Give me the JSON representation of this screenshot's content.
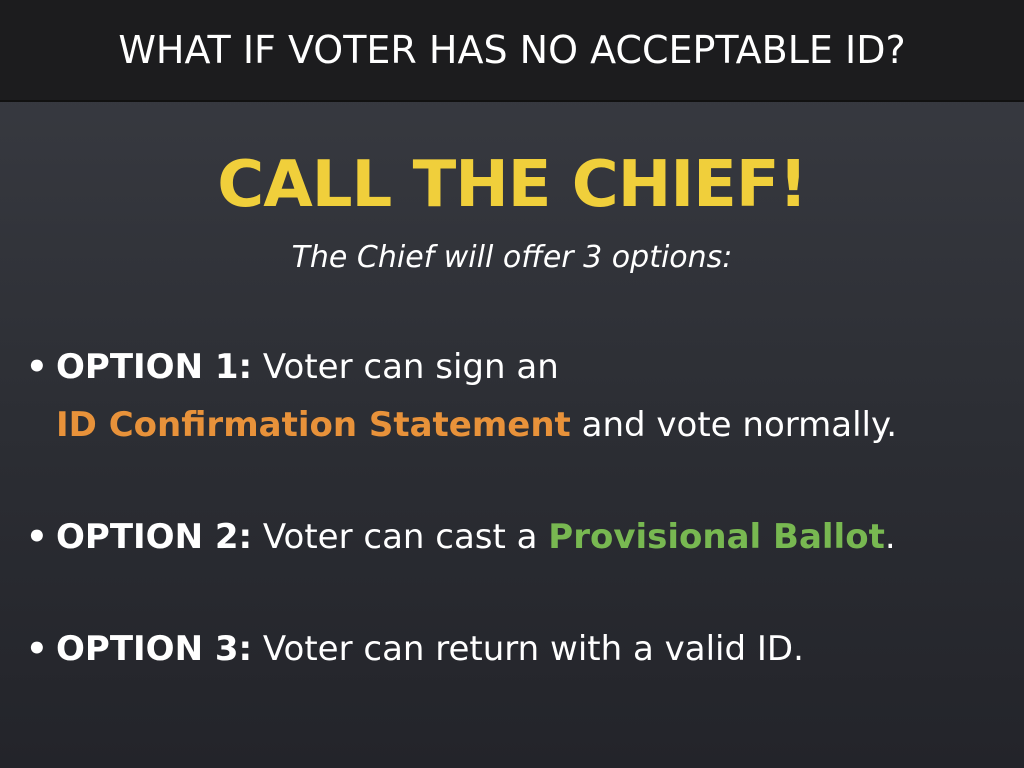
{
  "colors": {
    "headline": "#f0cf3b",
    "accent_orange": "#e8923a",
    "accent_green": "#78b851"
  },
  "header": {
    "title": "WHAT IF VOTER HAS NO ACCEPTABLE ID?"
  },
  "headline": "CALL THE CHIEF!",
  "subhead": "The Chief will offer 3 options:",
  "bullet_glyph": "•",
  "options": [
    {
      "label": "OPTION 1:",
      "text_before": " Voter can sign an",
      "highlight": "ID Confirmation Statement",
      "text_after": " and vote normally."
    },
    {
      "label": "OPTION 2:",
      "text_before": " Voter can cast a ",
      "highlight": "Provisional Ballot",
      "text_after": "."
    },
    {
      "label": "OPTION 3:",
      "text_before": " Voter can return with a valid ID."
    }
  ]
}
